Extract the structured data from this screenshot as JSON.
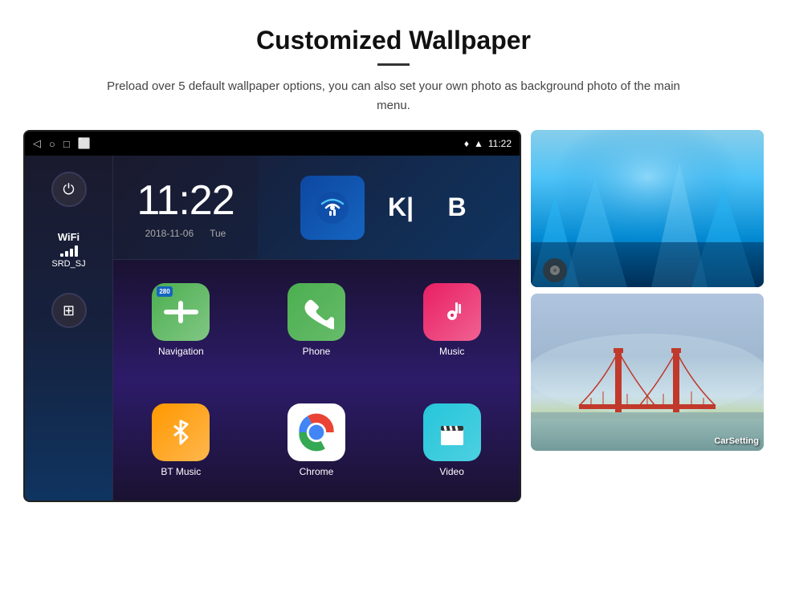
{
  "header": {
    "title": "Customized Wallpaper",
    "description": "Preload over 5 default wallpaper options, you can also set your own photo as background photo of the main menu."
  },
  "device": {
    "status_bar": {
      "time": "11:22",
      "nav_back": "◁",
      "nav_home": "○",
      "nav_recent": "□",
      "nav_screenshot": "⬜"
    },
    "clock": {
      "time": "11:22",
      "date": "2018-11-06",
      "day": "Tue"
    },
    "wifi": {
      "label": "WiFi",
      "network": "SRD_SJ"
    },
    "apps": [
      {
        "name": "Navigation",
        "row": 1,
        "col": 1
      },
      {
        "name": "Phone",
        "row": 1,
        "col": 2
      },
      {
        "name": "Music",
        "row": 1,
        "col": 3
      },
      {
        "name": "BT Music",
        "row": 2,
        "col": 1
      },
      {
        "name": "Chrome",
        "row": 2,
        "col": 2
      },
      {
        "name": "Video",
        "row": 2,
        "col": 3
      }
    ]
  },
  "wallpapers": [
    {
      "name": "Ice Cave",
      "label": ""
    },
    {
      "name": "Golden Gate Bridge",
      "label": "CarSetting"
    }
  ]
}
